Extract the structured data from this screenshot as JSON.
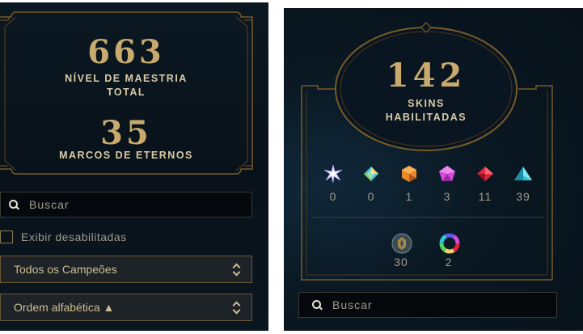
{
  "left": {
    "mastery": {
      "value": "663",
      "label_line1": "NÍVEL DE MAESTRIA",
      "label_line2": "TOTAL"
    },
    "eternals": {
      "value": "35",
      "label": "MARCOS DE ETERNOS"
    },
    "search": {
      "placeholder": "Buscar",
      "icon": "search-icon"
    },
    "show_disabled": {
      "label": "Exibir desabilitadas",
      "checked": false
    },
    "filter_select": {
      "value": "Todos os Campeões",
      "icon": "chevron-updown-icon"
    },
    "sort_select": {
      "value": "Ordem alfabética ▲",
      "icon": "chevron-updown-icon"
    }
  },
  "right": {
    "skins": {
      "value": "142",
      "label_line1": "SKINS",
      "label_line2": "HABILITADAS"
    },
    "rarity_gems": [
      {
        "icon": "transcendent-gem-icon",
        "count": "0",
        "color": "#e6e0ff"
      },
      {
        "icon": "ultimate-gem-icon",
        "count": "0",
        "color": "#f2d36b"
      },
      {
        "icon": "mythic-gem-icon",
        "count": "1",
        "color": "#e8892a"
      },
      {
        "icon": "legendary-gem-icon",
        "count": "3",
        "color": "#d44ad8"
      },
      {
        "icon": "epic-gem-icon",
        "count": "11",
        "color": "#e0263b"
      },
      {
        "icon": "rare-gem-icon",
        "count": "39",
        "color": "#2ec6d6"
      }
    ],
    "extras": [
      {
        "icon": "emblem-badge-icon",
        "count": "30"
      },
      {
        "icon": "chroma-wheel-icon",
        "count": "2"
      }
    ],
    "search": {
      "placeholder": "Buscar",
      "icon": "search-icon"
    }
  },
  "colors": {
    "gold": "#c8aa6e",
    "frame": "#785a28",
    "bg": "#0a141c",
    "text_muted": "#a09b8c"
  }
}
